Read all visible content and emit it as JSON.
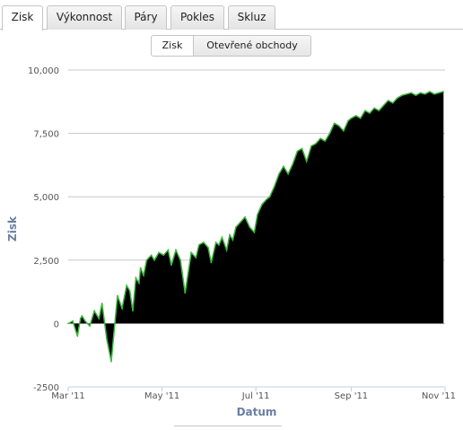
{
  "tabs": [
    {
      "label": "Zisk",
      "active": true
    },
    {
      "label": "Výkonnost",
      "active": false
    },
    {
      "label": "Páry",
      "active": false
    },
    {
      "label": "Pokles",
      "active": false
    },
    {
      "label": "Skluz",
      "active": false
    }
  ],
  "toggle": {
    "zisk_label": "Zisk",
    "obchody_label": "Otevřené obchody"
  },
  "chart_data": {
    "type": "area",
    "xlabel": "Datum",
    "ylabel": "Zisk",
    "yticks": [
      "10,000",
      "7,500",
      "5,000",
      "2,500",
      "0",
      "-2500"
    ],
    "ylim": [
      -2500,
      10000
    ],
    "xticks": [
      "Mar '11",
      "May '11",
      "Jul '11",
      "Sep '11",
      "Nov '11"
    ],
    "xlim": [
      "2011-03-01",
      "2011-11-01"
    ],
    "fill_color": "#000000",
    "line_color": "#3db83d",
    "grid": true,
    "series": [
      {
        "x": [
          "2011-03-01",
          "2011-03-04",
          "2011-03-07",
          "2011-03-09",
          "2011-03-10",
          "2011-03-12",
          "2011-03-15",
          "2011-03-18",
          "2011-03-21",
          "2011-03-23",
          "2011-03-26",
          "2011-03-29",
          "2011-04-02",
          "2011-04-05",
          "2011-04-08",
          "2011-04-10",
          "2011-04-12",
          "2011-04-14",
          "2011-04-16",
          "2011-04-17",
          "2011-04-19",
          "2011-04-21",
          "2011-04-24",
          "2011-04-26",
          "2011-04-29",
          "2011-05-02",
          "2011-05-05",
          "2011-05-07",
          "2011-05-10",
          "2011-05-13",
          "2011-05-16",
          "2011-05-20",
          "2011-05-23",
          "2011-05-25",
          "2011-05-28",
          "2011-05-31",
          "2011-06-02",
          "2011-06-05",
          "2011-06-07",
          "2011-06-09",
          "2011-06-12",
          "2011-06-14",
          "2011-06-16",
          "2011-06-18",
          "2011-06-21",
          "2011-06-24",
          "2011-06-27",
          "2011-06-30",
          "2011-07-02",
          "2011-07-05",
          "2011-07-08",
          "2011-07-10",
          "2011-07-13",
          "2011-07-16",
          "2011-07-19",
          "2011-07-22",
          "2011-07-25",
          "2011-07-28",
          "2011-07-31",
          "2011-08-03",
          "2011-08-06",
          "2011-08-09",
          "2011-08-12",
          "2011-08-15",
          "2011-08-18",
          "2011-08-21",
          "2011-08-24",
          "2011-08-27",
          "2011-08-30",
          "2011-09-01",
          "2011-09-04",
          "2011-09-07",
          "2011-09-10",
          "2011-09-13",
          "2011-09-16",
          "2011-09-19",
          "2011-09-22",
          "2011-09-25",
          "2011-09-28",
          "2011-10-01",
          "2011-10-04",
          "2011-10-07",
          "2011-10-10",
          "2011-10-13",
          "2011-10-16",
          "2011-10-19",
          "2011-10-22",
          "2011-10-25",
          "2011-10-28",
          "2011-10-31"
        ],
        "values": [
          0,
          100,
          -500,
          200,
          300,
          100,
          -100,
          500,
          200,
          800,
          -600,
          -1500,
          1100,
          600,
          1500,
          1300,
          500,
          1800,
          1600,
          2200,
          1900,
          2500,
          2700,
          2500,
          2800,
          2700,
          2900,
          2300,
          2900,
          2500,
          1200,
          2800,
          2600,
          3100,
          3200,
          3000,
          2400,
          3200,
          3100,
          3400,
          2900,
          3500,
          3300,
          3800,
          4000,
          4200,
          3800,
          3600,
          4300,
          4700,
          4900,
          5000,
          5400,
          5900,
          6200,
          5900,
          6300,
          6800,
          6900,
          6400,
          7000,
          7100,
          7300,
          7200,
          7500,
          7900,
          7800,
          7600,
          8000,
          8100,
          8200,
          8100,
          8400,
          8300,
          8500,
          8400,
          8600,
          8800,
          8700,
          8900,
          9000,
          9050,
          9100,
          9000,
          9100,
          9050,
          9150,
          9050,
          9100,
          9150
        ]
      }
    ]
  }
}
